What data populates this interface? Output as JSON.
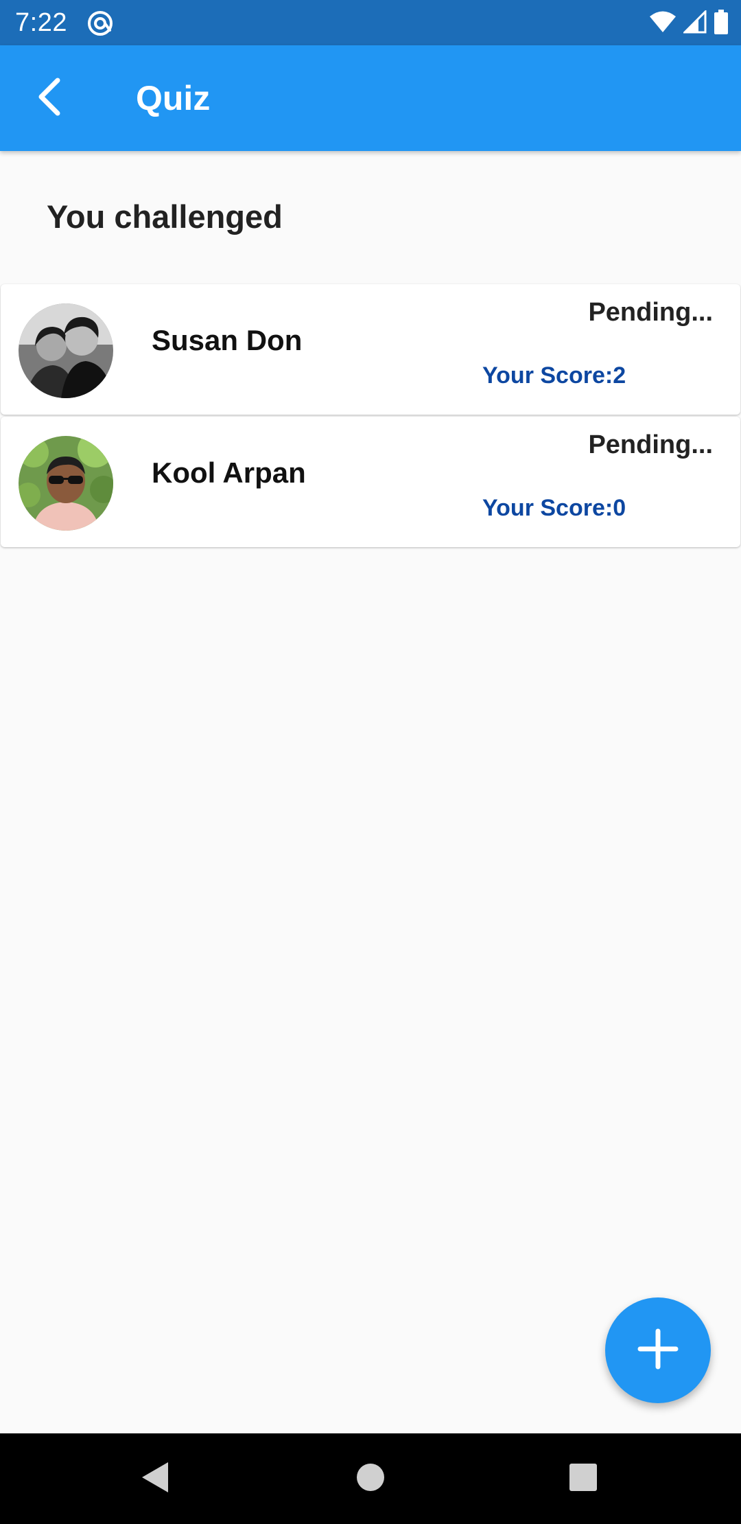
{
  "status_bar": {
    "time": "7:22",
    "icons": [
      "at-sign-icon",
      "wifi-icon",
      "cell-signal-icon",
      "battery-icon"
    ]
  },
  "app_bar": {
    "title": "Quiz",
    "back_icon": "back-arrow-icon",
    "background": "#2196f3"
  },
  "section": {
    "title": "You challenged"
  },
  "challenges": [
    {
      "name": "Susan Don",
      "status": "Pending...",
      "score": "Your Score:2",
      "avatar": "avatar-photo"
    },
    {
      "name": "Kool Arpan",
      "status": "Pending...",
      "score": "Your Score:0",
      "avatar": "avatar-photo"
    }
  ],
  "fab": {
    "icon": "plus-icon"
  },
  "nav": {
    "icons": [
      "back-triangle-icon",
      "home-circle-icon",
      "recents-square-icon"
    ]
  },
  "colors": {
    "status_bar": "#1c6db8",
    "accent": "#2196f3",
    "score_text": "#0d47a1",
    "background": "#fafafa"
  }
}
